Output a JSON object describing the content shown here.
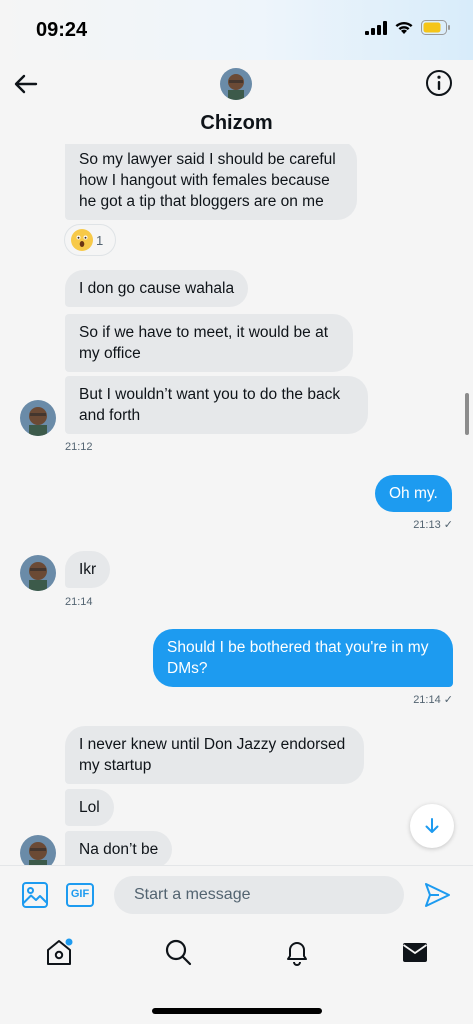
{
  "status_bar": {
    "time": "09:24"
  },
  "header": {
    "contact_name": "Chizom"
  },
  "messages": [
    {
      "direction": "in",
      "text": "So my lawyer said I should be careful how I hangout with females because he got a tip that bloggers are on me"
    },
    {
      "direction": "in",
      "text": "I don go cause wahala"
    },
    {
      "direction": "in",
      "text": "So if we have to meet, it would be at my office"
    },
    {
      "direction": "in",
      "text": "But I wouldn’t want you to do the back and forth",
      "time": "21:12"
    },
    {
      "direction": "out",
      "text": "Oh my.",
      "time": "21:13 ✓"
    },
    {
      "direction": "in",
      "text": "Ikr",
      "time": "21:14"
    },
    {
      "direction": "out",
      "text": "Should I be bothered that you're in my DMs?",
      "time": "21:14 ✓"
    },
    {
      "direction": "in",
      "text": "I never knew until Don Jazzy endorsed my startup"
    },
    {
      "direction": "in",
      "text": "Lol"
    },
    {
      "direction": "in",
      "text": "Na don’t be"
    }
  ],
  "reaction": {
    "emoji": "astonished-face-emoji",
    "count": "1"
  },
  "composer": {
    "placeholder": "Start a message",
    "gif_label": "GIF"
  },
  "icons": {
    "back": "arrow-left-icon",
    "info": "info-icon",
    "image": "image-icon",
    "gif": "gif-icon",
    "send": "send-icon",
    "scroll_down": "arrow-down-icon",
    "nav": [
      "home-icon",
      "search-icon",
      "bell-icon",
      "mail-icon"
    ]
  },
  "colors": {
    "accent": "#1d9bf0",
    "incoming_bubble": "#e6e8ea",
    "background": "#f5f5f5",
    "battery": "#f5c518"
  }
}
